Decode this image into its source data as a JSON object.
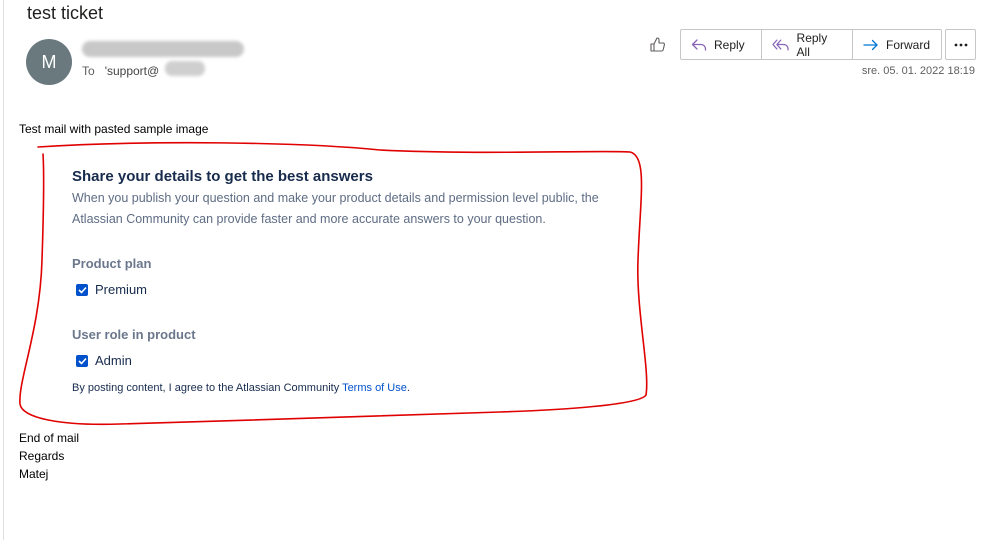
{
  "email": {
    "subject": "test ticket",
    "avatar_initial": "M",
    "to_label": "To",
    "to_address": "'support@",
    "date": "sre. 05. 01. 2022 18:19"
  },
  "toolbar": {
    "like_icon": "thumbs-up-icon",
    "reply_label": "Reply",
    "reply_all_label": "Reply All",
    "forward_label": "Forward",
    "more_icon": "more-icon"
  },
  "body": {
    "intro": "Test mail with pasted  sample image",
    "closing": [
      "End of mail",
      "Regards",
      "Matej"
    ]
  },
  "pasted_image": {
    "title": "Share your details to get the best answers",
    "description": "When you publish your question and make your product details and permission level public, the Atlassian Community can provide faster and more accurate answers to your question.",
    "product_plan_label": "Product plan",
    "product_plan_value": "Premium",
    "user_role_label": "User role in product",
    "user_role_value": "Admin",
    "terms_text": "By posting content, I agree to the Atlassian Community ",
    "terms_link": "Terms of Use",
    "terms_end": "."
  },
  "colors": {
    "annotation": "#e00000",
    "avatar": "#69797e",
    "link": "#0052cc",
    "checkbox": "#0052cc"
  }
}
